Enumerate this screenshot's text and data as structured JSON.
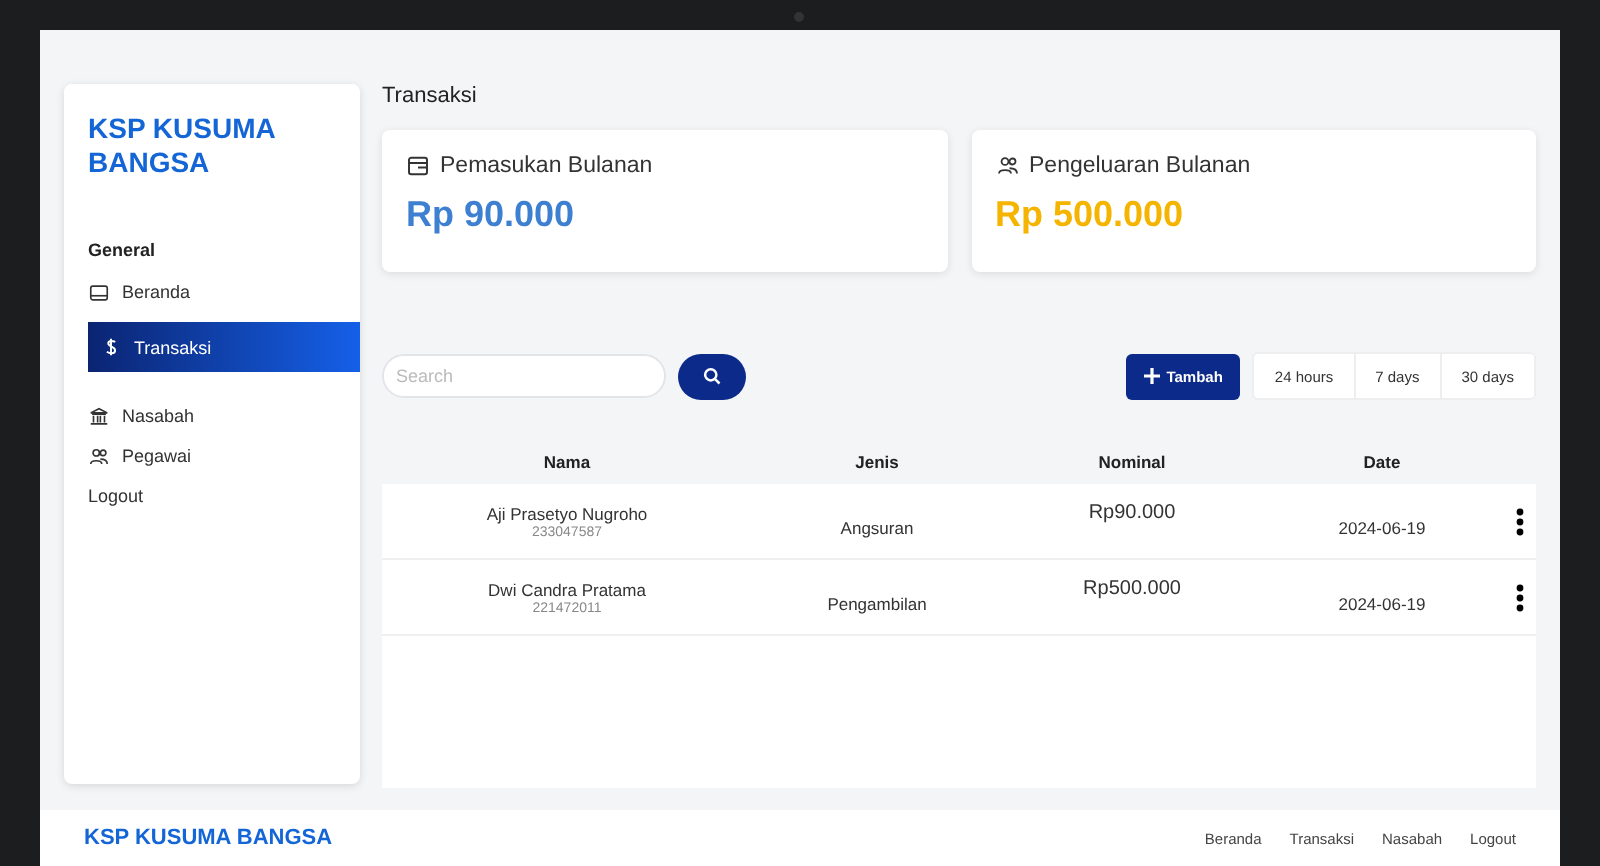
{
  "brand": "KSP KUSUMA BANGSA",
  "sidebar": {
    "section": "General",
    "items": [
      {
        "label": "Beranda",
        "selected": false
      },
      {
        "label": "Transaksi",
        "selected": true
      },
      {
        "label": "Nasabah",
        "selected": false
      },
      {
        "label": "Pegawai",
        "selected": false
      },
      {
        "label": "Logout",
        "selected": false
      }
    ]
  },
  "page_title": "Transaksi",
  "stat_cards": [
    {
      "kind": "income",
      "title": "Pemasukan Bulanan",
      "value": "Rp 90.000"
    },
    {
      "kind": "expense",
      "title": "Pengeluaran Bulanan",
      "value": "Rp 500.000"
    }
  ],
  "search": {
    "placeholder": "Search"
  },
  "add_button": "Tambah",
  "range_buttons": [
    "24 hours",
    "7 days",
    "30 days"
  ],
  "table": {
    "columns": [
      "Nama",
      "Jenis",
      "Nominal",
      "Date"
    ],
    "rows": [
      {
        "name": "Aji Prasetyo Nugroho",
        "id": "233047587",
        "jenis": "Angsuran",
        "nominal": "Rp90.000",
        "date": "2024-06-19"
      },
      {
        "name": "Dwi Candra Pratama",
        "id": "221472011",
        "jenis": "Pengambilan",
        "nominal": "Rp500.000",
        "date": "2024-06-19"
      }
    ]
  },
  "footer": {
    "brand": "KSP KUSUMA BANGSA",
    "links": [
      "Beranda",
      "Transaksi",
      "Nasabah",
      "Logout"
    ]
  }
}
